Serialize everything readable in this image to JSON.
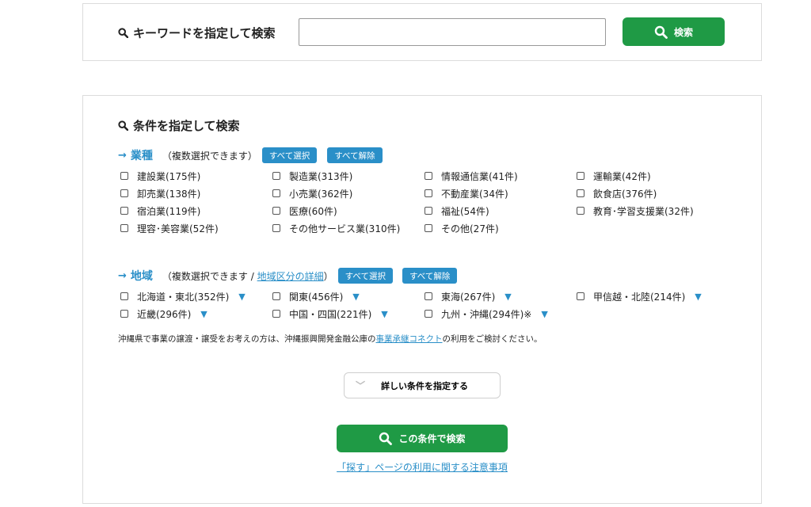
{
  "keyword": {
    "label": "キーワードを指定して検索",
    "input_value": "",
    "button_label": "検索"
  },
  "conditions": {
    "title": "条件を指定して検索",
    "industry": {
      "arrow": "→",
      "name": "業種",
      "note": "（複数選択できます）",
      "select_all": "すべて選択",
      "clear_all": "すべて解除",
      "options": [
        "建設業(175件)",
        "製造業(313件)",
        "情報通信業(41件)",
        "運輸業(42件)",
        "卸売業(138件)",
        "小売業(362件)",
        "不動産業(34件)",
        "飲食店(376件)",
        "宿泊業(119件)",
        "医療(60件)",
        "福祉(54件)",
        "教育･学習支援業(32件)",
        "理容･美容業(52件)",
        "その他サービス業(310件)",
        "その他(27件)"
      ]
    },
    "region": {
      "arrow": "→",
      "name": "地域",
      "note_prefix": "（複数選択できます / ",
      "note_link": "地域区分の詳細",
      "note_suffix": "）",
      "select_all": "すべて選択",
      "clear_all": "すべて解除",
      "expand_marker": "▼",
      "options": [
        "北海道・東北(352件)",
        "関東(456件)",
        "東海(267件)",
        "甲信越・北陸(214件)",
        "近畿(296件)",
        "中国・四国(221件)",
        "九州・沖縄(294件)※"
      ]
    },
    "notice": {
      "prefix": "沖縄県で事業の譲渡・譲受をお考えの方は、沖縄振興開発金融公庫の",
      "link": "事業承継コネクト",
      "suffix": "の利用をご検討ください。"
    },
    "detail_button": "詳しい条件を指定する",
    "search_button": "この条件で検索",
    "caution_link": "「探す」ページの利用に関する注意事項"
  },
  "colors": {
    "green": "#1f9a45",
    "blue": "#2a8fc8"
  }
}
